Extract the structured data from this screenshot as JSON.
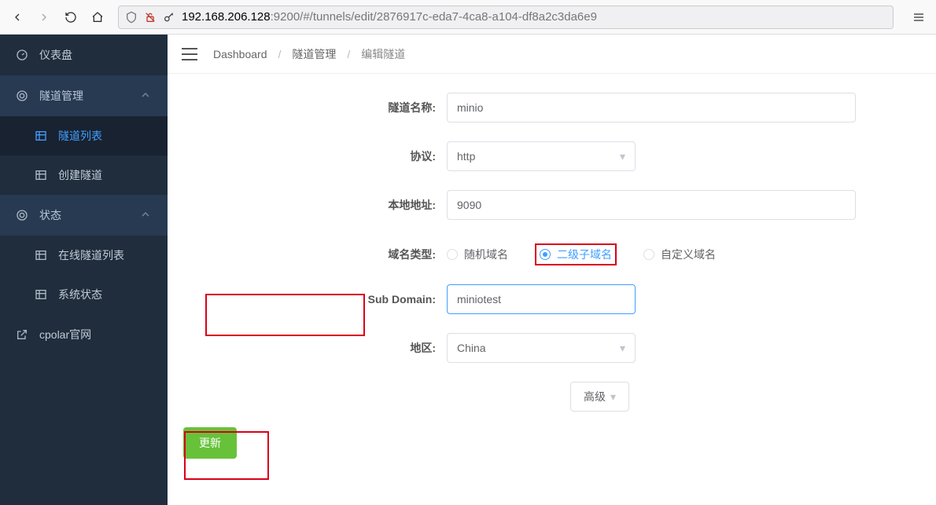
{
  "browser": {
    "url_host": "192.168.206.128",
    "url_path": ":9200/#/tunnels/edit/2876917c-eda7-4ca8-a104-df8a2c3da6e9"
  },
  "sidebar": {
    "dashboard": "仪表盘",
    "tunnel_mgmt": "隧道管理",
    "tunnel_list": "隧道列表",
    "create_tunnel": "创建隧道",
    "status": "状态",
    "online_list": "在线隧道列表",
    "sys_status": "系统状态",
    "cpolar_site": "cpolar官网"
  },
  "breadcrumb": {
    "a": "Dashboard",
    "b": "隧道管理",
    "c": "编辑隧道"
  },
  "form": {
    "name_label": "隧道名称:",
    "name_value": "minio",
    "proto_label": "协议:",
    "proto_value": "http",
    "addr_label": "本地地址:",
    "addr_value": "9090",
    "domain_type_label": "域名类型:",
    "domain_opts": {
      "random": "随机域名",
      "second": "二级子域名",
      "custom": "自定义域名"
    },
    "subdomain_label": "Sub Domain:",
    "subdomain_value": "miniotest",
    "region_label": "地区:",
    "region_value": "China",
    "advanced": "高级",
    "submit": "更新"
  }
}
